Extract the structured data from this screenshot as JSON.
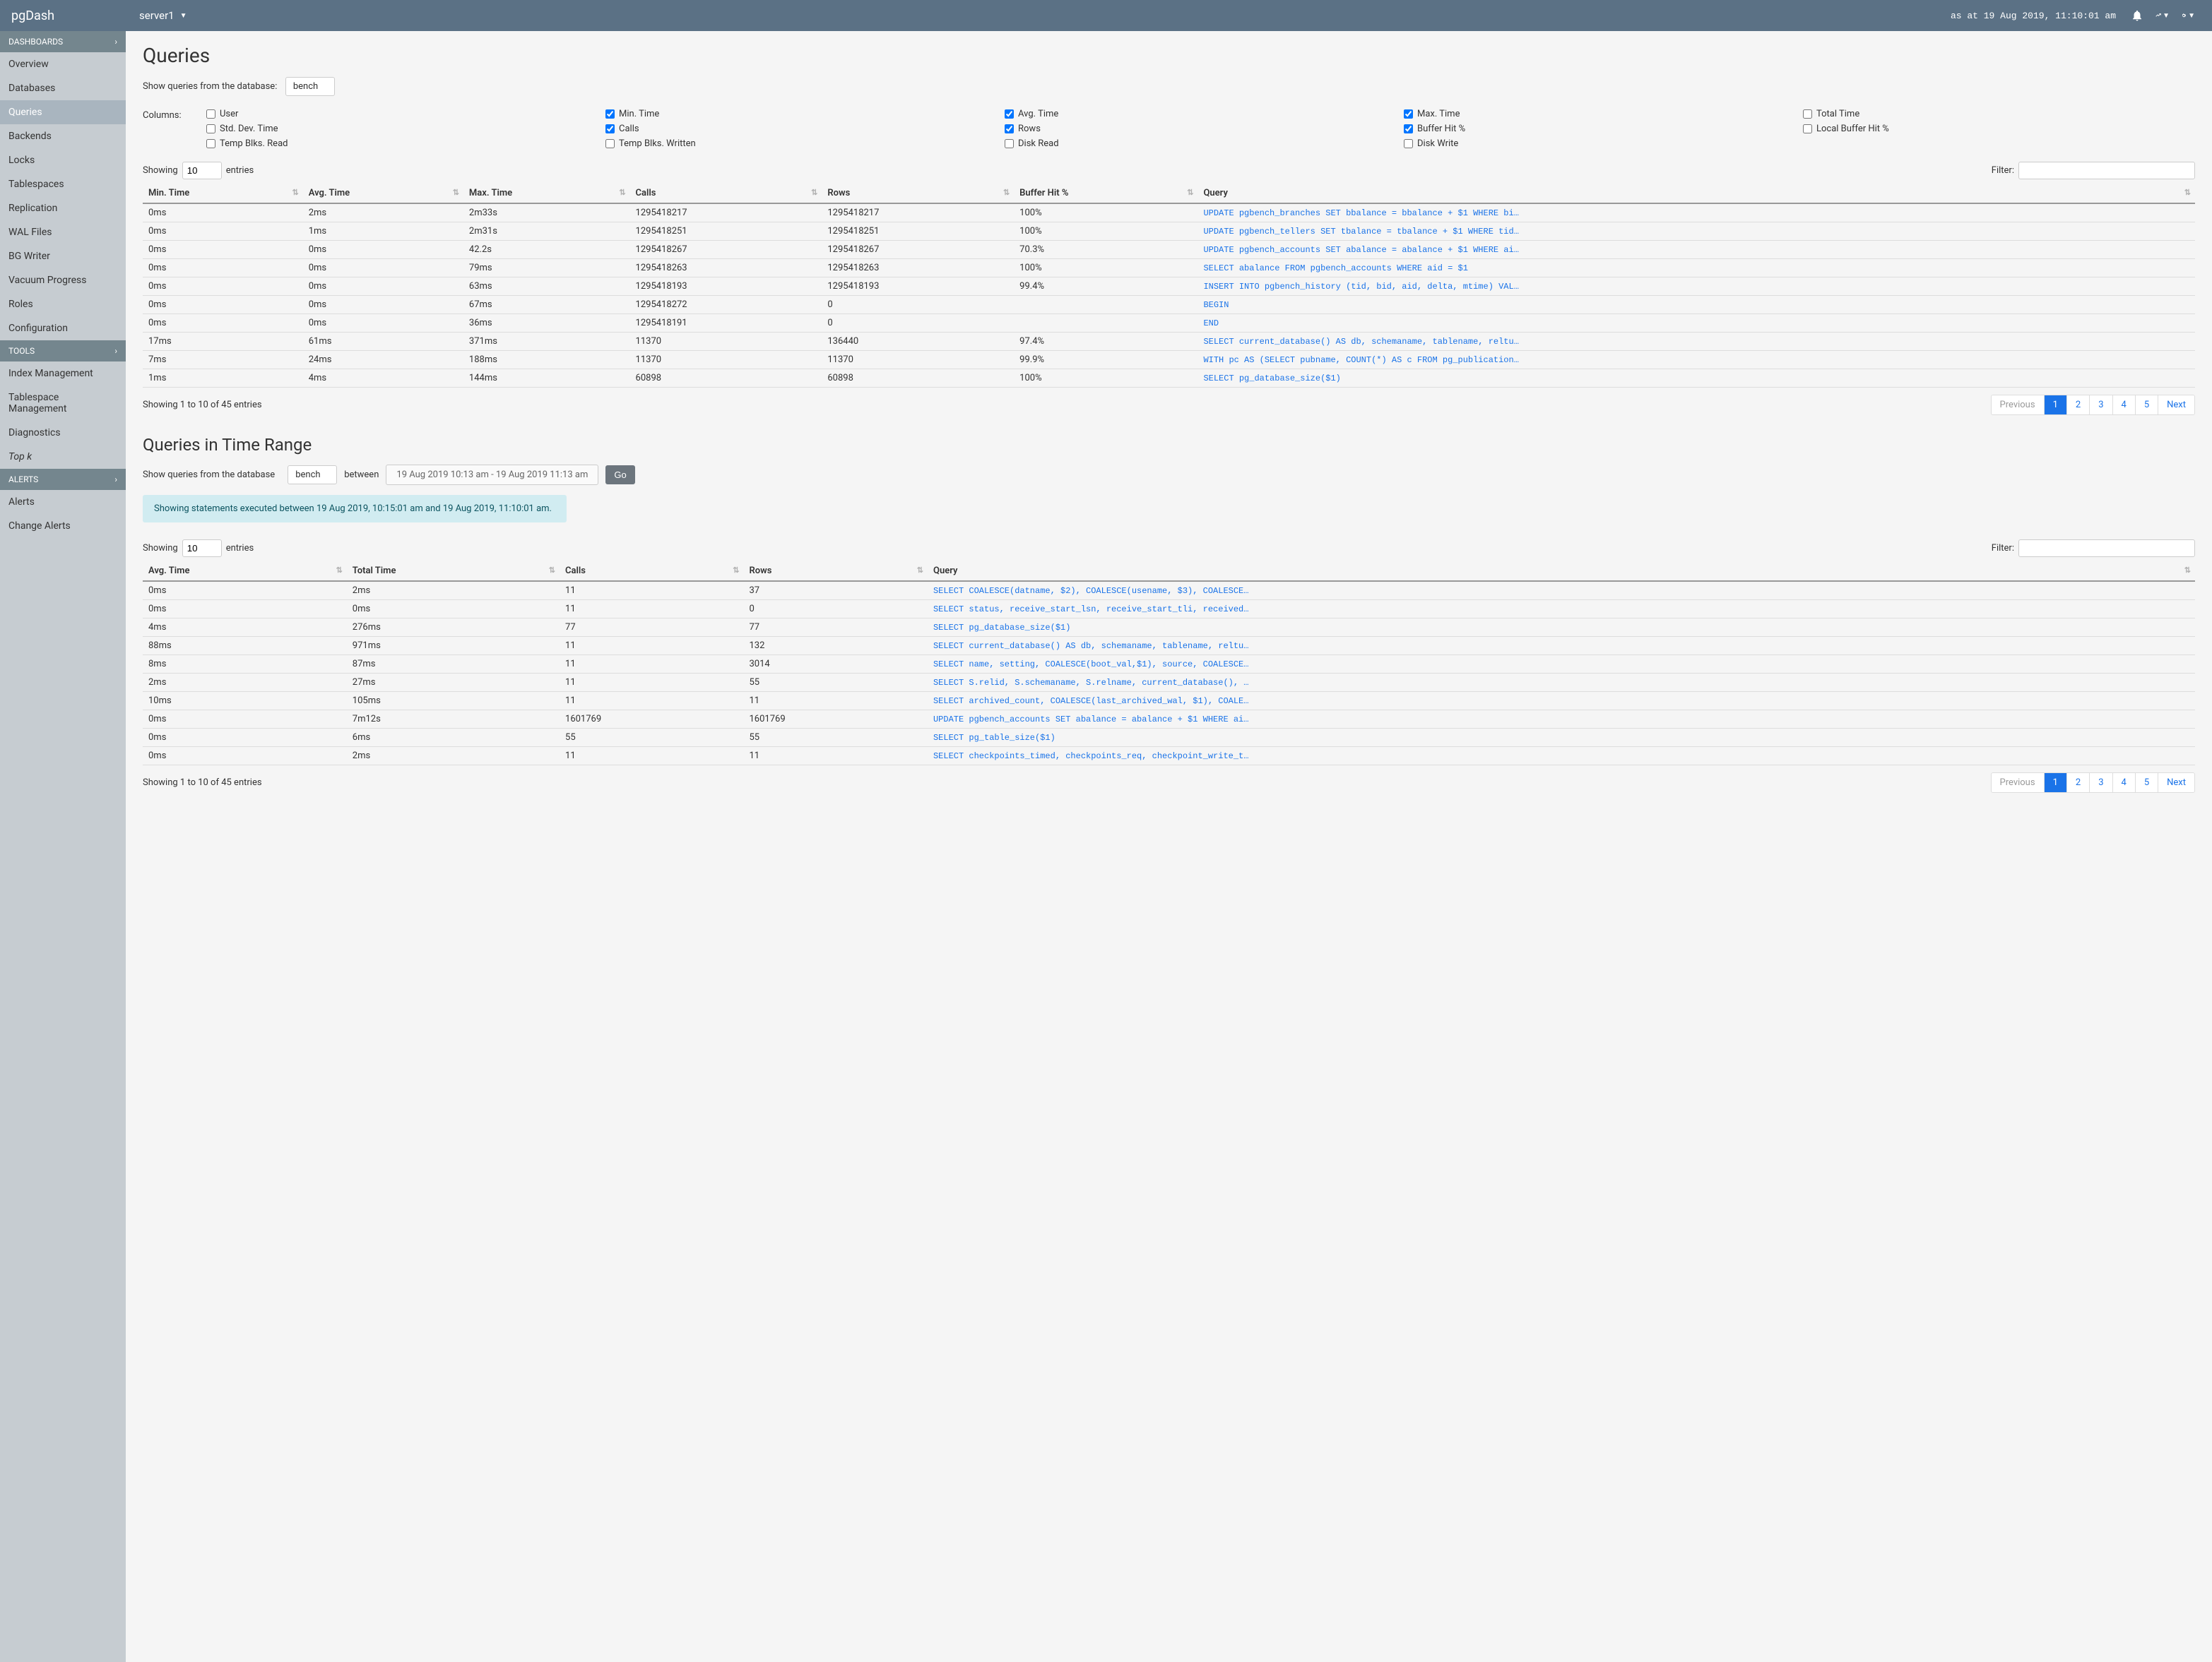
{
  "topbar": {
    "brand": "pgDash",
    "server": "server1",
    "timestamp": "as at 19 Aug 2019, 11:10:01 am"
  },
  "sidebar": {
    "sections": [
      {
        "title": "DASHBOARDS",
        "items": [
          "Overview",
          "Databases",
          "Queries",
          "Backends",
          "Locks",
          "Tablespaces",
          "Replication",
          "WAL Files",
          "BG Writer",
          "Vacuum Progress",
          "Roles",
          "Configuration"
        ],
        "active": 2
      },
      {
        "title": "TOOLS",
        "items": [
          "Index Management",
          "Tablespace Management",
          "Diagnostics",
          "Top k"
        ],
        "italic": 3
      },
      {
        "title": "ALERTS",
        "items": [
          "Alerts",
          "Change Alerts"
        ]
      }
    ]
  },
  "queries": {
    "title": "Queries",
    "db_label": "Show queries from the database:",
    "db_value": "bench",
    "columns_label": "Columns:",
    "column_groups": [
      [
        {
          "label": "User",
          "checked": false
        },
        {
          "label": "Std. Dev. Time",
          "checked": false
        },
        {
          "label": "Temp Blks. Read",
          "checked": false
        }
      ],
      [
        {
          "label": "Min. Time",
          "checked": true
        },
        {
          "label": "Calls",
          "checked": true
        },
        {
          "label": "Temp Blks. Written",
          "checked": false
        }
      ],
      [
        {
          "label": "Avg. Time",
          "checked": true
        },
        {
          "label": "Rows",
          "checked": true
        },
        {
          "label": "Disk Read",
          "checked": false
        }
      ],
      [
        {
          "label": "Max. Time",
          "checked": true
        },
        {
          "label": "Buffer Hit %",
          "checked": true
        },
        {
          "label": "Disk Write",
          "checked": false
        }
      ],
      [
        {
          "label": "Total Time",
          "checked": false
        },
        {
          "label": "Local Buffer Hit %",
          "checked": false
        }
      ]
    ],
    "showing_label_pre": "Showing",
    "showing_value": "10",
    "showing_label_post": "entries",
    "filter_label": "Filter:",
    "headers": [
      "Min. Time",
      "Avg. Time",
      "Max. Time",
      "Calls",
      "Rows",
      "Buffer Hit %",
      "Query"
    ],
    "rows": [
      [
        "0ms",
        "2ms",
        "2m33s",
        "1295418217",
        "1295418217",
        "100%",
        "UPDATE pgbench_branches SET bbalance = bbalance + $1 WHERE bi…"
      ],
      [
        "0ms",
        "1ms",
        "2m31s",
        "1295418251",
        "1295418251",
        "100%",
        "UPDATE pgbench_tellers SET tbalance = tbalance + $1 WHERE tid…"
      ],
      [
        "0ms",
        "0ms",
        "42.2s",
        "1295418267",
        "1295418267",
        "70.3%",
        "UPDATE pgbench_accounts SET abalance = abalance + $1 WHERE ai…"
      ],
      [
        "0ms",
        "0ms",
        "79ms",
        "1295418263",
        "1295418263",
        "100%",
        "SELECT abalance FROM pgbench_accounts WHERE aid = $1"
      ],
      [
        "0ms",
        "0ms",
        "63ms",
        "1295418193",
        "1295418193",
        "99.4%",
        "INSERT INTO pgbench_history (tid, bid, aid, delta, mtime) VAL…"
      ],
      [
        "0ms",
        "0ms",
        "67ms",
        "1295418272",
        "0",
        "",
        "BEGIN"
      ],
      [
        "0ms",
        "0ms",
        "36ms",
        "1295418191",
        "0",
        "",
        "END"
      ],
      [
        "17ms",
        "61ms",
        "371ms",
        "11370",
        "136440",
        "97.4%",
        "SELECT current_database() AS db, schemaname, tablename, reltu…"
      ],
      [
        "7ms",
        "24ms",
        "188ms",
        "11370",
        "11370",
        "99.9%",
        "WITH pc AS (SELECT pubname, COUNT(*) AS c FROM pg_publication…"
      ],
      [
        "1ms",
        "4ms",
        "144ms",
        "60898",
        "60898",
        "100%",
        "SELECT pg_database_size($1)"
      ]
    ],
    "footer_text": "Showing 1 to 10 of 45 entries",
    "pagination": [
      "Previous",
      "1",
      "2",
      "3",
      "4",
      "5",
      "Next"
    ],
    "page_active": 1
  },
  "timerange": {
    "title": "Queries in Time Range",
    "db_label": "Show queries from the database",
    "db_value": "bench",
    "between_label": "between",
    "range": "19 Aug 2019 10:13 am - 19 Aug 2019 11:13 am",
    "go_label": "Go",
    "info": "Showing statements executed between 19 Aug 2019, 10:15:01 am and 19 Aug 2019, 11:10:01 am.",
    "showing_value": "10",
    "headers": [
      "Avg. Time",
      "Total Time",
      "Calls",
      "Rows",
      "Query"
    ],
    "rows": [
      [
        "0ms",
        "2ms",
        "11",
        "37",
        "SELECT COALESCE(datname, $2), COALESCE(usename, $3), COALESCE…"
      ],
      [
        "0ms",
        "0ms",
        "11",
        "0",
        "SELECT status, receive_start_lsn, receive_start_tli, received…"
      ],
      [
        "4ms",
        "276ms",
        "77",
        "77",
        "SELECT pg_database_size($1)"
      ],
      [
        "88ms",
        "971ms",
        "11",
        "132",
        "SELECT current_database() AS db, schemaname, tablename, reltu…"
      ],
      [
        "8ms",
        "87ms",
        "11",
        "3014",
        "SELECT name, setting, COALESCE(boot_val,$1), source, COALESCE…"
      ],
      [
        "2ms",
        "27ms",
        "11",
        "55",
        "SELECT S.relid, S.schemaname, S.relname, current_database(), …"
      ],
      [
        "10ms",
        "105ms",
        "11",
        "11",
        "SELECT archived_count, COALESCE(last_archived_wal, $1), COALE…"
      ],
      [
        "0ms",
        "7m12s",
        "1601769",
        "1601769",
        "UPDATE pgbench_accounts SET abalance = abalance + $1 WHERE ai…"
      ],
      [
        "0ms",
        "6ms",
        "55",
        "55",
        "SELECT pg_table_size($1)"
      ],
      [
        "0ms",
        "2ms",
        "11",
        "11",
        "SELECT checkpoints_timed, checkpoints_req, checkpoint_write_t…"
      ]
    ],
    "footer_text": "Showing 1 to 10 of 45 entries",
    "pagination": [
      "Previous",
      "1",
      "2",
      "3",
      "4",
      "5",
      "Next"
    ],
    "page_active": 1
  }
}
